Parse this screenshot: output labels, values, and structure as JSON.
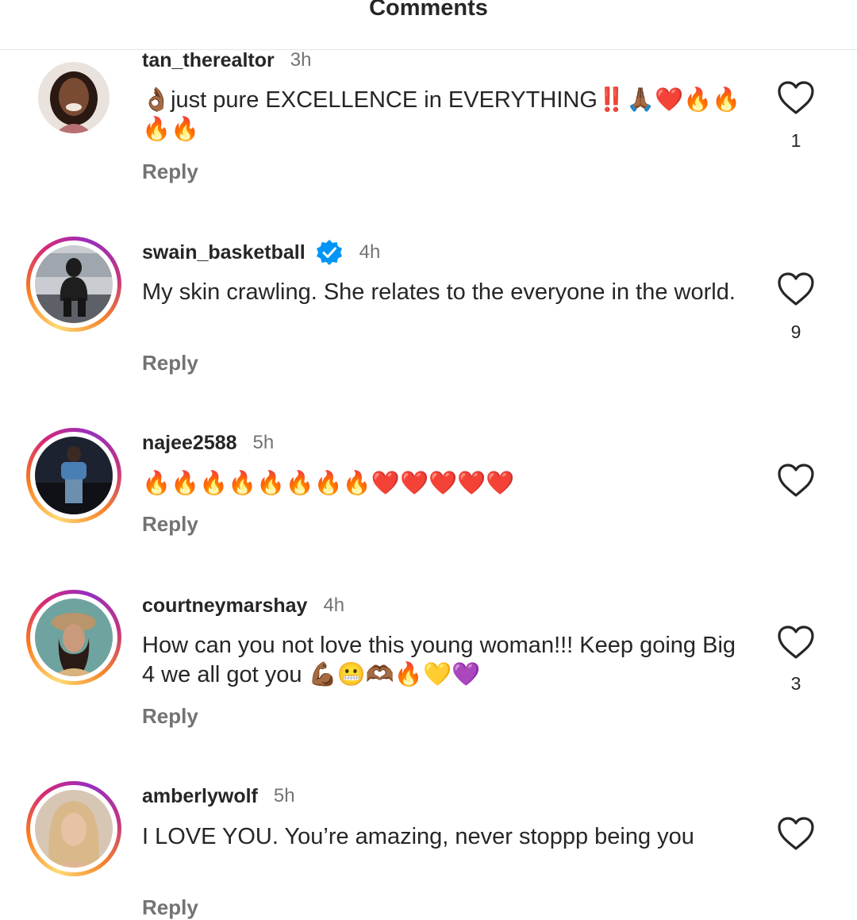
{
  "header": {
    "title": "Comments"
  },
  "comments": [
    {
      "username": "tan_therealtor",
      "time": "3h",
      "text": "👌🏾just pure EXCELLENCE in EVERYTHING‼️🙏🏾❤️🔥🔥🔥🔥",
      "reply_label": "Reply",
      "likes": "1",
      "verified": false,
      "story_ring": false
    },
    {
      "username": "swain_basketball",
      "time": "4h",
      "text": "My skin crawling. She relates to the everyone in the world.",
      "reply_label": "Reply",
      "likes": "9",
      "verified": true,
      "story_ring": true
    },
    {
      "username": "najee2588",
      "time": "5h",
      "text": "🔥🔥🔥🔥🔥🔥🔥🔥❤️❤️❤️❤️❤️",
      "reply_label": "Reply",
      "likes": "",
      "verified": false,
      "story_ring": true
    },
    {
      "username": "courtneymarshay",
      "time": "4h",
      "text": "How can you not love this young woman!!! Keep going Big 4 we all got you 💪🏾😬🫶🏾🔥💛💜",
      "reply_label": "Reply",
      "likes": "3",
      "verified": false,
      "story_ring": true
    },
    {
      "username": "amberlywolf",
      "time": "5h",
      "text": "I LOVE YOU. You’re amazing, never stoppp being you",
      "reply_label": "Reply",
      "likes": "",
      "verified": false,
      "story_ring": true
    }
  ],
  "icons": {
    "like": "heart-outline-icon",
    "verified": "verified-badge-icon"
  },
  "colors": {
    "text": "#262626",
    "secondary": "#737373",
    "verified": "#0095f6"
  }
}
